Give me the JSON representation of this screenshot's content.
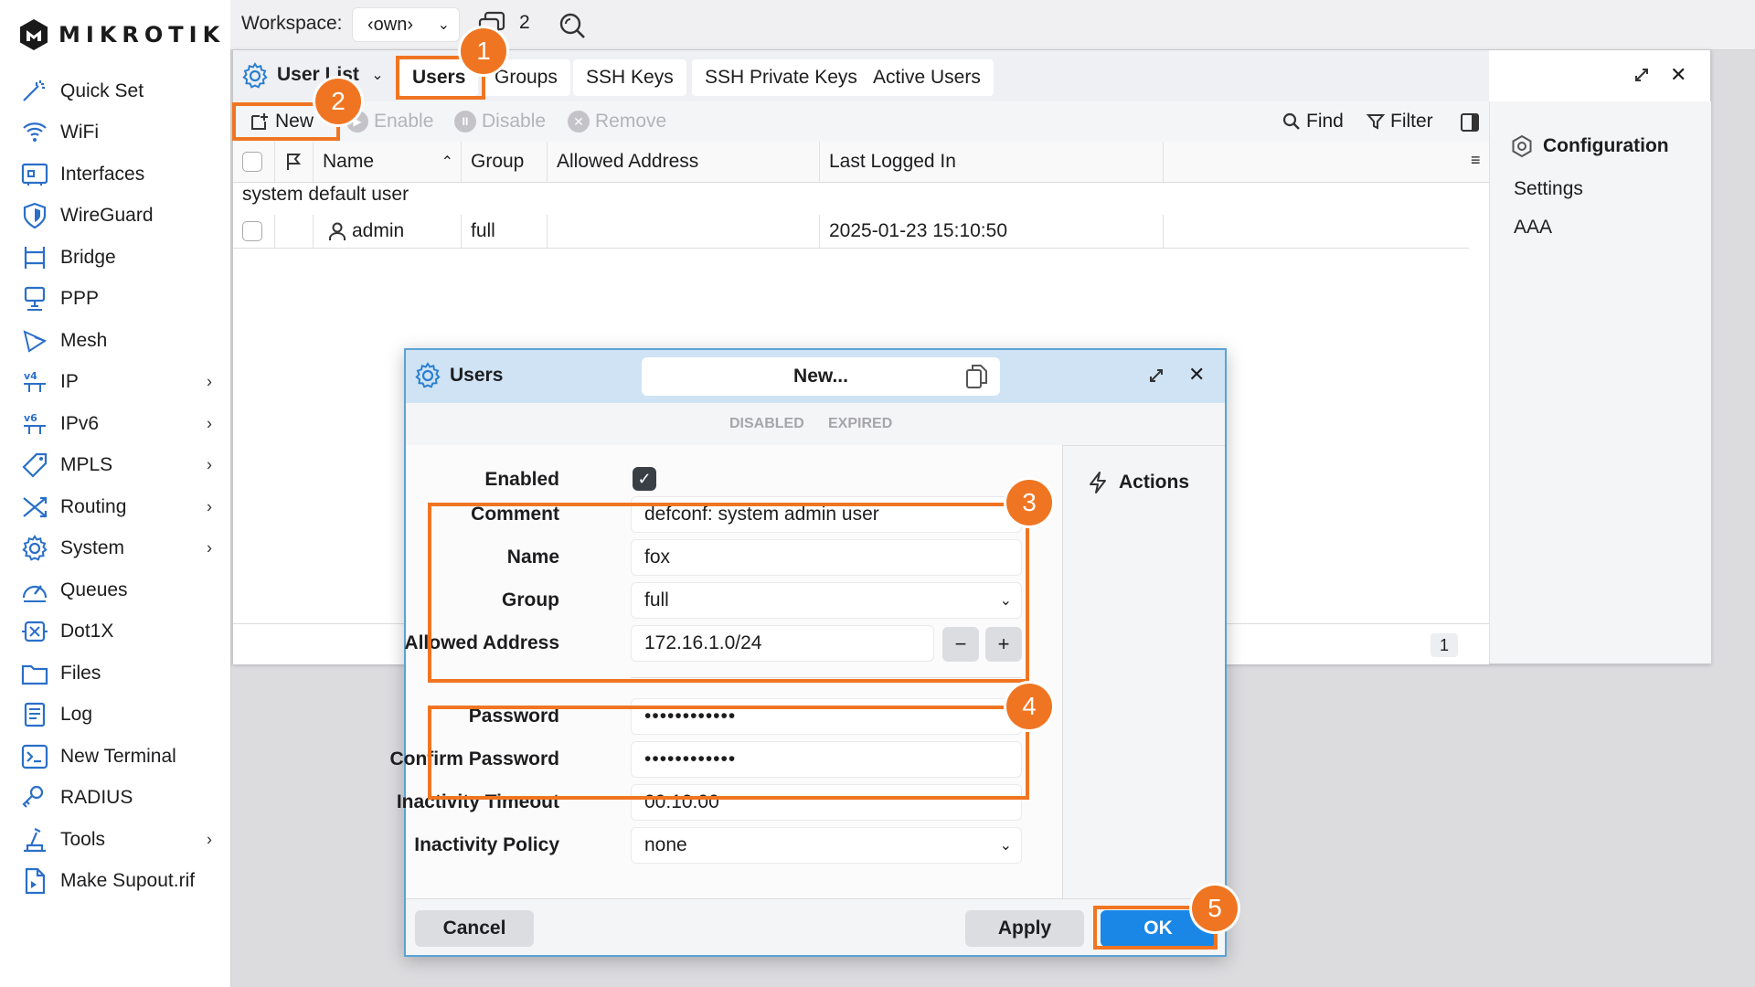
{
  "brand": {
    "name": "MIKROTIK"
  },
  "sidebar": {
    "items": [
      {
        "label": "Quick Set",
        "icon": "wand-icon",
        "chevron": false
      },
      {
        "label": "WiFi",
        "icon": "wifi-icon",
        "chevron": false
      },
      {
        "label": "Interfaces",
        "icon": "interfaces-icon",
        "chevron": false
      },
      {
        "label": "WireGuard",
        "icon": "shield-icon",
        "chevron": false
      },
      {
        "label": "Bridge",
        "icon": "bridge-icon",
        "chevron": false
      },
      {
        "label": "PPP",
        "icon": "ppp-icon",
        "chevron": false
      },
      {
        "label": "Mesh",
        "icon": "mesh-icon",
        "chevron": false
      },
      {
        "label": "IP",
        "icon": "ip-icon",
        "chevron": true
      },
      {
        "label": "IPv6",
        "icon": "ipv6-icon",
        "chevron": true
      },
      {
        "label": "MPLS",
        "icon": "tag-icon",
        "chevron": true
      },
      {
        "label": "Routing",
        "icon": "routing-icon",
        "chevron": true
      },
      {
        "label": "System",
        "icon": "gear-icon",
        "chevron": true
      },
      {
        "label": "Queues",
        "icon": "gauge-icon",
        "chevron": false
      },
      {
        "label": "Dot1X",
        "icon": "dot1x-icon",
        "chevron": false
      },
      {
        "label": "Files",
        "icon": "folder-icon",
        "chevron": false
      },
      {
        "label": "Log",
        "icon": "log-icon",
        "chevron": false
      },
      {
        "label": "New Terminal",
        "icon": "terminal-icon",
        "chevron": false
      },
      {
        "label": "RADIUS",
        "icon": "radius-icon",
        "chevron": false
      },
      {
        "label": "Tools",
        "icon": "tools-icon",
        "chevron": true
      },
      {
        "label": "Make Supout.rif",
        "icon": "file-icon",
        "chevron": false
      }
    ]
  },
  "topbar": {
    "workspace_label": "Workspace:",
    "workspace_value": "‹own›",
    "window_count": "2"
  },
  "main_window": {
    "title": "User List",
    "tabs": [
      "Users",
      "Groups",
      "SSH Keys",
      "SSH Private Keys",
      "Active Users"
    ],
    "active_tab": "Users",
    "toolbar": {
      "new": "New",
      "enable": "Enable",
      "disable": "Disable",
      "remove": "Remove",
      "find": "Find",
      "filter": "Filter"
    },
    "columns": [
      "Name",
      "Group",
      "Allowed Address",
      "Last Logged In"
    ],
    "group_label": "system default user",
    "rows": [
      {
        "name": "admin",
        "group": "full",
        "allowed_address": "",
        "last_logged_in": "2025-01-23 15:10:50"
      }
    ],
    "row_count": "1",
    "right_panel": {
      "heading": "Configuration",
      "items": [
        "Settings",
        "AAA"
      ]
    }
  },
  "dialog": {
    "title": "Users",
    "mode": "New...",
    "flags": [
      "DISABLED",
      "EXPIRED"
    ],
    "fields": {
      "enabled_label": "Enabled",
      "enabled": true,
      "comment_label": "Comment",
      "comment": "defconf: system admin user",
      "name_label": "Name",
      "name": "fox",
      "group_label": "Group",
      "group": "full",
      "allowed_label": "Allowed Address",
      "allowed": "172.16.1.0/24",
      "password_label": "Password",
      "password": "••••••••••••",
      "confirm_label": "Confirm Password",
      "confirm": "••••••••••••",
      "timeout_label": "Inactivity Timeout",
      "timeout": "00:10:00",
      "policy_label": "Inactivity Policy",
      "policy": "none"
    },
    "actions_label": "Actions",
    "buttons": {
      "cancel": "Cancel",
      "apply": "Apply",
      "ok": "OK"
    }
  },
  "annotations": [
    "1",
    "2",
    "3",
    "4",
    "5"
  ],
  "colors": {
    "accent": "#f07522",
    "ok_button": "#1a87e6",
    "dialog_titlebar": "#cfe3f5"
  }
}
